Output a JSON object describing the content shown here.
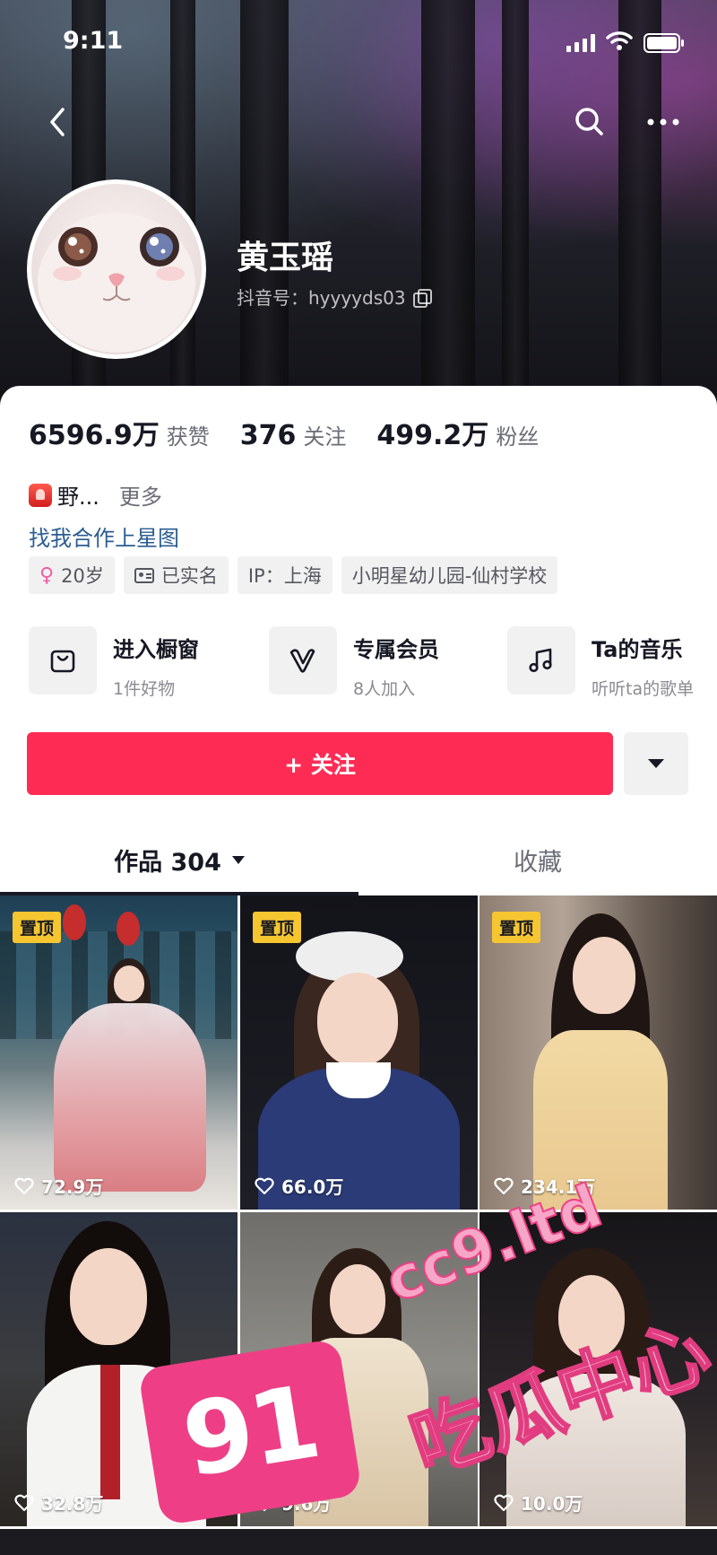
{
  "status_bar": {
    "time": "9:11"
  },
  "profile": {
    "name": "黄玉瑶",
    "douyin_id": "抖音号：hyyyyds03"
  },
  "stats": [
    {
      "value": "6596.9万",
      "label": "获赞"
    },
    {
      "value": "376",
      "label": "关注"
    },
    {
      "value": "499.2万",
      "label": "粉丝"
    }
  ],
  "bio": {
    "text": "野...",
    "more": "更多"
  },
  "star_link": "找我合作上星图",
  "tags": {
    "age": "20岁",
    "verified": "已实名",
    "ip": "IP：上海",
    "school": "小明星幼儿园-仙村学校"
  },
  "services": [
    {
      "title": "进入橱窗",
      "subtitle": "1件好物",
      "icon": "shopping-bag-icon"
    },
    {
      "title": "专属会员",
      "subtitle": "8人加入",
      "icon": "member-v-icon"
    },
    {
      "title": "Ta的音乐",
      "subtitle": "听听ta的歌单",
      "icon": "music-note-icon"
    }
  ],
  "follow_button": "+ 关注",
  "tabs": {
    "works": "作品 304",
    "favorites": "收藏"
  },
  "videos": [
    {
      "pinned": "置顶",
      "likes": "72.9万"
    },
    {
      "pinned": "置顶",
      "likes": "66.0万"
    },
    {
      "pinned": "置顶",
      "likes": "234.1万"
    },
    {
      "pinned": "",
      "likes": "32.8万"
    },
    {
      "pinned": "",
      "likes": "9.6万"
    },
    {
      "pinned": "",
      "likes": "10.0万"
    }
  ],
  "watermark": {
    "badge": "91",
    "domain": "cc9.ltd",
    "slogan": "吃瓜中心"
  },
  "colors": {
    "accent": "#fe2c55",
    "link": "#2b5c91",
    "pin_badge": "#f6c631",
    "watermark": "#ee3f86"
  }
}
